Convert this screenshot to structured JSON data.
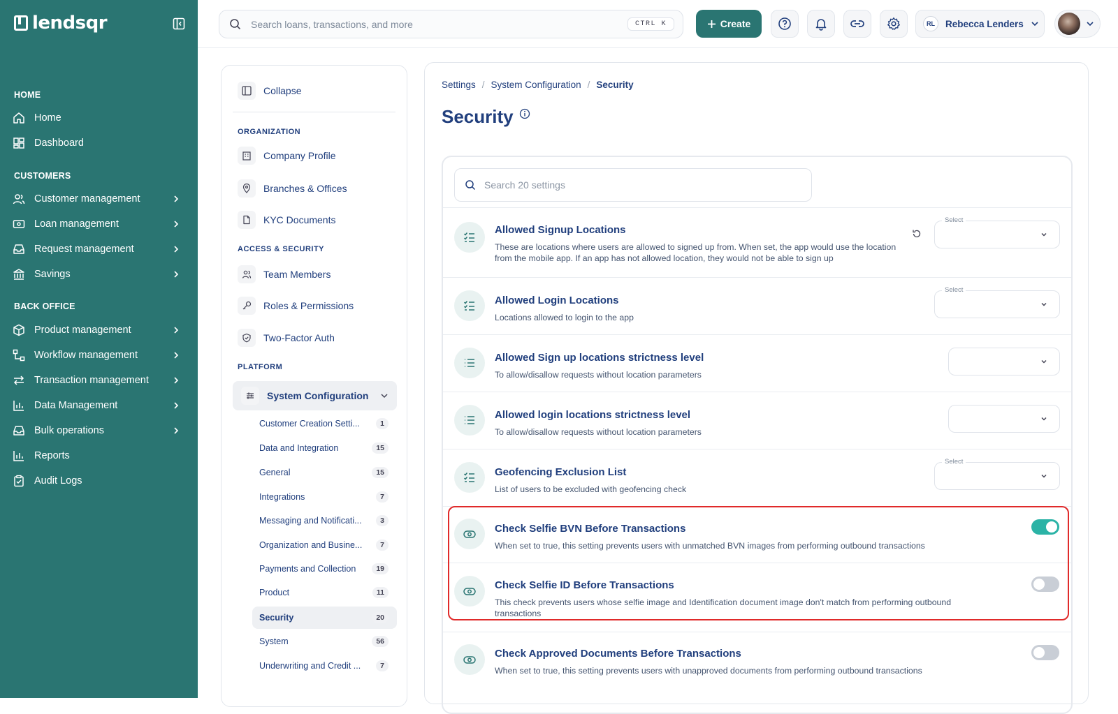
{
  "brand": {
    "name": "lendsqr"
  },
  "nav": {
    "sections": [
      "HOME",
      "CUSTOMERS",
      "BACK OFFICE"
    ],
    "items": [
      {
        "label": "Home"
      },
      {
        "label": "Dashboard"
      },
      {
        "label": "Customer management"
      },
      {
        "label": "Loan management"
      },
      {
        "label": "Request management"
      },
      {
        "label": "Savings"
      },
      {
        "label": "Product management"
      },
      {
        "label": "Workflow management"
      },
      {
        "label": "Transaction management"
      },
      {
        "label": "Data Management"
      },
      {
        "label": "Bulk operations"
      },
      {
        "label": "Reports"
      },
      {
        "label": "Audit Logs"
      }
    ]
  },
  "topbar": {
    "search_placeholder": "Search loans, transactions, and more",
    "shortcut": "CTRL K",
    "create_label": "Create",
    "user_initials": "RL",
    "user_name": "Rebecca Lenders"
  },
  "settings_nav": {
    "collapse_label": "Collapse",
    "groups": [
      {
        "label": "ORGANIZATION",
        "items": [
          "Company Profile",
          "Branches & Offices",
          "KYC Documents"
        ]
      },
      {
        "label": "ACCESS & SECURITY",
        "items": [
          "Team Members",
          "Roles & Permissions",
          "Two-Factor Auth"
        ]
      },
      {
        "label": "PLATFORM",
        "items": [
          "System Configuration"
        ]
      }
    ],
    "sub_items": [
      {
        "label": "Customer Creation Setti...",
        "count": "1"
      },
      {
        "label": "Data and Integration",
        "count": "15"
      },
      {
        "label": "General",
        "count": "15"
      },
      {
        "label": "Integrations",
        "count": "7"
      },
      {
        "label": "Messaging and Notificati...",
        "count": "3"
      },
      {
        "label": "Organization and Busine...",
        "count": "7"
      },
      {
        "label": "Payments and Collection",
        "count": "19"
      },
      {
        "label": "Product",
        "count": "11"
      },
      {
        "label": "Security",
        "count": "20"
      },
      {
        "label": "System",
        "count": "56"
      },
      {
        "label": "Underwriting and Credit ...",
        "count": "7"
      }
    ]
  },
  "breadcrumb": [
    "Settings",
    "System Configuration",
    "Security"
  ],
  "page_title": "Security",
  "settings_search_placeholder": "Search 20 settings",
  "select_label": "Select",
  "settings": [
    {
      "title": "Allowed Signup Locations",
      "desc": "These are locations where users are allowed to signed up from. When set, the app would use the location from the mobile app. If an app has not allowed location, they would not be able to sign up",
      "control": "select",
      "icon": "checklist-icon"
    },
    {
      "title": "Allowed Login Locations",
      "desc": "Locations allowed to login to the app",
      "control": "select",
      "icon": "checklist-icon"
    },
    {
      "title": "Allowed Sign up locations strictness level",
      "desc": "To allow/disallow requests without location parameters",
      "control": "dropdown",
      "icon": "list-icon"
    },
    {
      "title": "Allowed login locations strictness level",
      "desc": "To allow/disallow requests without location parameters",
      "control": "dropdown",
      "icon": "list-icon"
    },
    {
      "title": "Geofencing Exclusion List",
      "desc": "List of users to be excluded with geofencing check",
      "control": "select",
      "icon": "checklist-icon"
    },
    {
      "title": "Check Selfie BVN Before Transactions",
      "desc": "When set to true, this setting prevents users with unmatched BVN images from performing outbound transactions",
      "control": "toggle",
      "on": true,
      "icon": "toggle-icon"
    },
    {
      "title": "Check Selfie ID Before Transactions",
      "desc": "This check prevents users whose selfie image and Identification document image don't match from performing outbound transactions",
      "control": "toggle",
      "on": false,
      "icon": "toggle-icon"
    },
    {
      "title": "Check Approved Documents Before Transactions",
      "desc": "When set to true, this setting prevents users with unapproved documents from performing outbound transactions",
      "control": "toggle",
      "on": false,
      "icon": "toggle-icon"
    }
  ],
  "colors": {
    "brand": "#2a7572",
    "toggle_on": "#2bb3a6",
    "toggle_off": "#c9ced6",
    "highlight": "#e02a2a"
  }
}
